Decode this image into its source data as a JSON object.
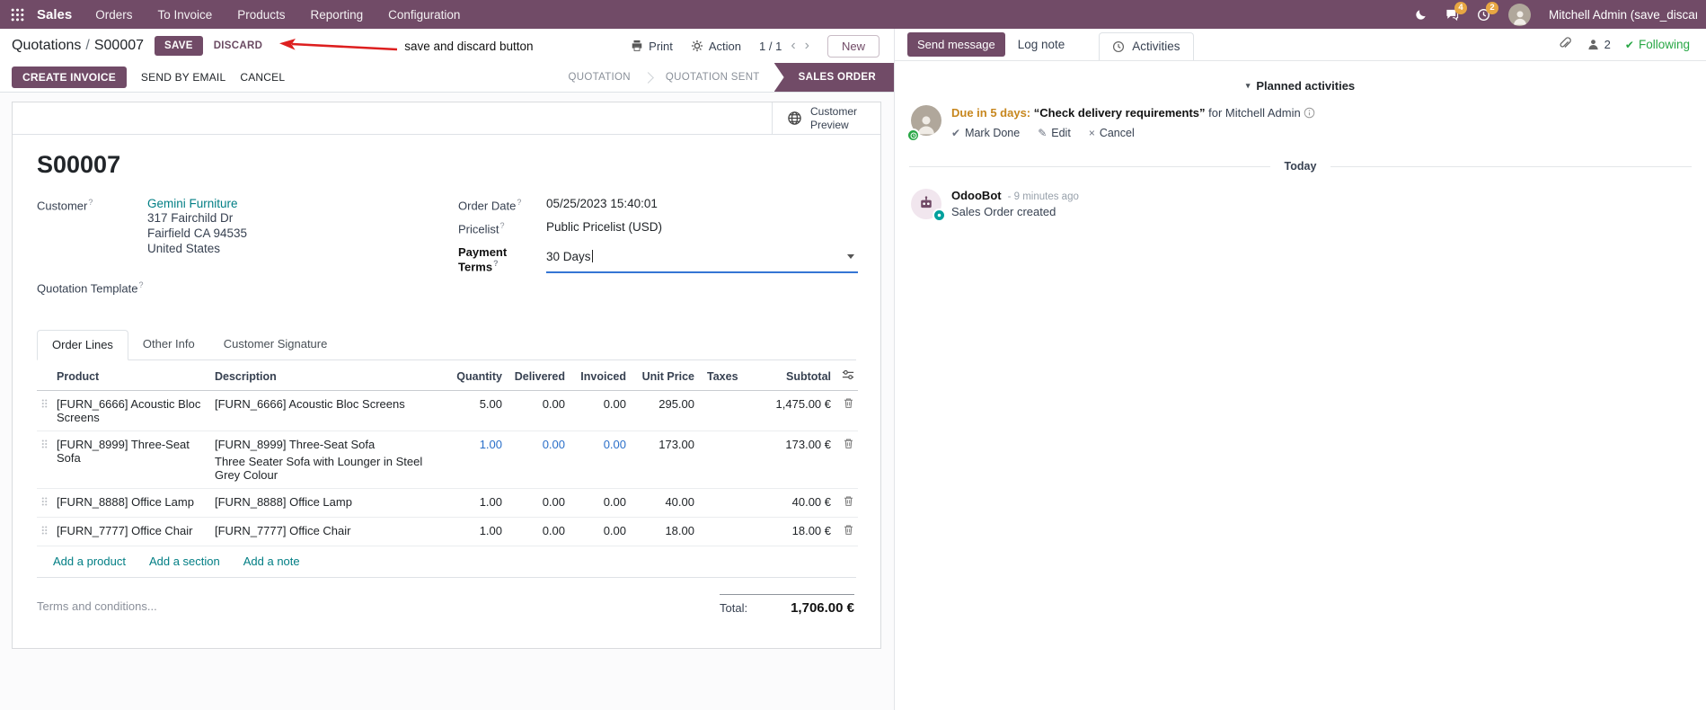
{
  "ui": {
    "help_marker": "?",
    "breadcrumb_separator": "/"
  },
  "navbar": {
    "brand": "Sales",
    "menus": [
      "Orders",
      "To Invoice",
      "Products",
      "Reporting",
      "Configuration"
    ],
    "messages_badge": "4",
    "activities_badge": "2",
    "user_name": "Mitchell Admin (save_discar"
  },
  "control_panel": {
    "breadcrumb_parent": "Quotations",
    "breadcrumb_current": "S00007",
    "save_label": "SAVE",
    "discard_label": "DISCARD",
    "annotation_text": "save and discard button",
    "print_label": "Print",
    "action_label": "Action",
    "pager_value": "1 / 1",
    "pager_prev": "‹",
    "pager_next": "›",
    "new_label": "New"
  },
  "statusbar": {
    "create_invoice": "CREATE INVOICE",
    "send_by_email": "SEND BY EMAIL",
    "cancel": "CANCEL",
    "stages": [
      "QUOTATION",
      "QUOTATION SENT",
      "SALES ORDER"
    ],
    "active_stage": "SALES ORDER"
  },
  "sheet": {
    "customer_preview_label": "Customer Preview",
    "title": "S00007",
    "customer_label": "Customer",
    "customer_name": "Gemini Furniture",
    "customer_address_1": "317 Fairchild Dr",
    "customer_address_2": "Fairfield CA 94535",
    "customer_address_3": "United States",
    "quotation_template_label": "Quotation Template",
    "order_date_label": "Order Date",
    "order_date_value": "05/25/2023 15:40:01",
    "pricelist_label": "Pricelist",
    "pricelist_value": "Public Pricelist (USD)",
    "payment_terms_label": "Payment Terms",
    "payment_terms_value": "30 Days",
    "tabs": [
      "Order Lines",
      "Other Info",
      "Customer Signature"
    ],
    "table": {
      "headers": {
        "product": "Product",
        "description": "Description",
        "quantity": "Quantity",
        "delivered": "Delivered",
        "invoiced": "Invoiced",
        "unit_price": "Unit Price",
        "taxes": "Taxes",
        "subtotal": "Subtotal"
      },
      "rows": [
        {
          "product": "[FURN_6666] Acoustic Bloc Screens",
          "description": "[FURN_6666] Acoustic Bloc Screens",
          "description_line2": "",
          "quantity": "5.00",
          "delivered": "0.00",
          "invoiced": "0.00",
          "unit_price": "295.00",
          "taxes": "",
          "subtotal": "1,475.00 €"
        },
        {
          "product": "[FURN_8999] Three-Seat Sofa",
          "description": "[FURN_8999] Three-Seat Sofa",
          "description_line2": "Three Seater Sofa with Lounger in Steel Grey Colour",
          "quantity": "1.00",
          "delivered": "0.00",
          "invoiced": "0.00",
          "unit_price": "173.00",
          "taxes": "",
          "subtotal": "173.00 €"
        },
        {
          "product": "[FURN_8888] Office Lamp",
          "description": "[FURN_8888] Office Lamp",
          "description_line2": "",
          "quantity": "1.00",
          "delivered": "0.00",
          "invoiced": "0.00",
          "unit_price": "40.00",
          "taxes": "",
          "subtotal": "40.00 €"
        },
        {
          "product": "[FURN_7777] Office Chair",
          "description": "[FURN_7777] Office Chair",
          "description_line2": "",
          "quantity": "1.00",
          "delivered": "0.00",
          "invoiced": "0.00",
          "unit_price": "18.00",
          "taxes": "",
          "subtotal": "18.00 €"
        }
      ],
      "add_product": "Add a product",
      "add_section": "Add a section",
      "add_note": "Add a note"
    },
    "terms_placeholder": "Terms and conditions...",
    "total_label": "Total:",
    "total_value": "1,706.00 €"
  },
  "chatter": {
    "send_message": "Send message",
    "log_note": "Log note",
    "activities_tab": "Activities",
    "followers_count": "2",
    "following_label": "Following",
    "following_check": "✔",
    "planned_header": "Planned activities",
    "activity": {
      "due": "Due in 5 days:",
      "summary": "“Check delivery requirements”",
      "assignee": "for Mitchell Admin",
      "mark_done": "Mark Done",
      "edit": "Edit",
      "cancel": "Cancel"
    },
    "date_separator": "Today",
    "message": {
      "author": "OdooBot",
      "time": "- 9 minutes ago",
      "body": "Sales Order created"
    }
  }
}
